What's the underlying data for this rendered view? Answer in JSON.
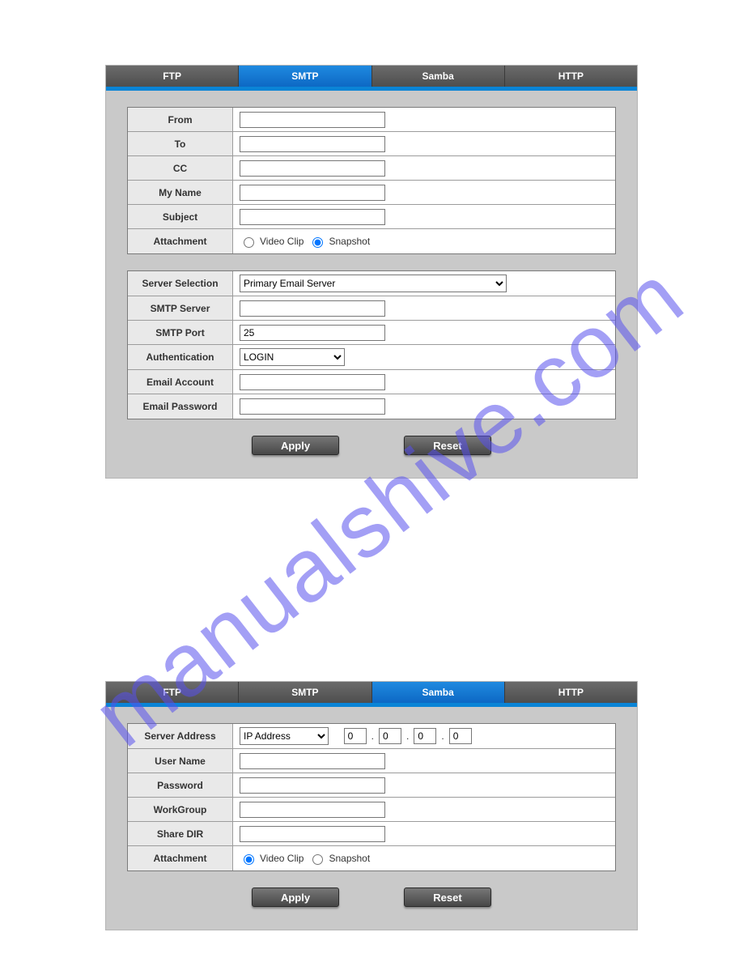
{
  "watermark": "manualshive.com",
  "smtp_panel": {
    "tabs": [
      "FTP",
      "SMTP",
      "Samba",
      "HTTP"
    ],
    "active_tab": 1,
    "group1": {
      "labels": {
        "from": "From",
        "to": "To",
        "cc": "CC",
        "myname": "My Name",
        "subject": "Subject",
        "attachment": "Attachment"
      },
      "values": {
        "from": "",
        "to": "",
        "cc": "",
        "myname": "",
        "subject": ""
      },
      "attachment_options": {
        "video": "Video Clip",
        "snapshot": "Snapshot"
      },
      "attachment_selected": "snapshot"
    },
    "group2": {
      "labels": {
        "server_selection": "Server Selection",
        "smtp_server": "SMTP Server",
        "smtp_port": "SMTP Port",
        "authentication": "Authentication",
        "email_account": "Email Account",
        "email_password": "Email Password"
      },
      "values": {
        "server_selection": "Primary Email Server",
        "smtp_server": "",
        "smtp_port": "25",
        "authentication": "LOGIN",
        "email_account": "",
        "email_password": ""
      }
    },
    "buttons": {
      "apply": "Apply",
      "reset": "Reset"
    }
  },
  "samba_panel": {
    "tabs": [
      "FTP",
      "SMTP",
      "Samba",
      "HTTP"
    ],
    "active_tab": 2,
    "labels": {
      "server_address": "Server Address",
      "user_name": "User Name",
      "password": "Password",
      "workgroup": "WorkGroup",
      "share_dir": "Share DIR",
      "attachment": "Attachment"
    },
    "values": {
      "address_type": "IP Address",
      "ip": [
        "0",
        "0",
        "0",
        "0"
      ],
      "user_name": "",
      "password": "",
      "workgroup": "",
      "share_dir": ""
    },
    "attachment_options": {
      "video": "Video Clip",
      "snapshot": "Snapshot"
    },
    "attachment_selected": "video",
    "buttons": {
      "apply": "Apply",
      "reset": "Reset"
    }
  }
}
